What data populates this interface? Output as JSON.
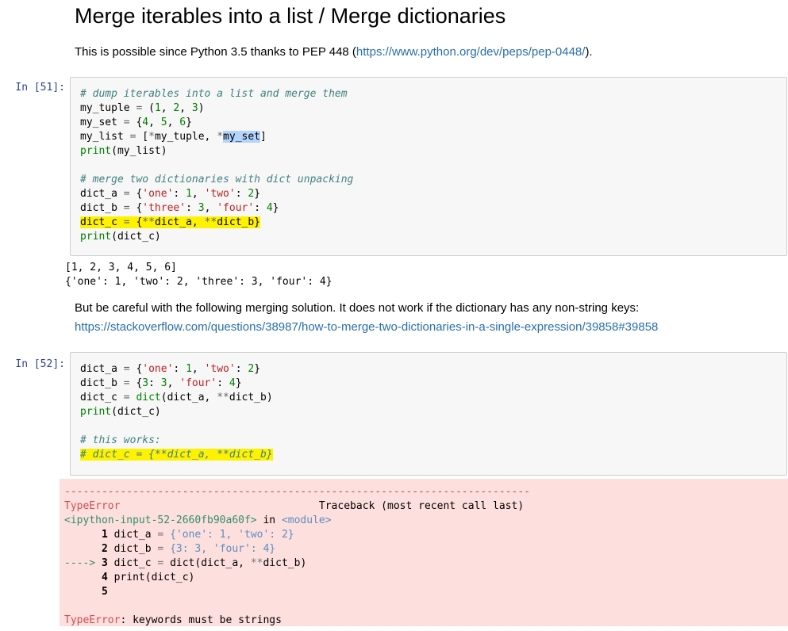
{
  "heading": "Merge iterables into a list / Merge dictionaries",
  "intro": {
    "prefix": "This is possible since Python 3.5 thanks to PEP 448 (",
    "link": "https://www.python.org/dev/peps/pep-0448/",
    "suffix": ")."
  },
  "cell51": {
    "prompt": "In [51]:",
    "comment1": "# dump iterables into a list and merge them",
    "comment2": "# merge two dictionaries with dict unpacking",
    "output": [
      "[1, 2, 3, 4, 5, 6]",
      "{'one': 1, 'two': 2, 'three': 3, 'four': 4}"
    ]
  },
  "note": {
    "text": "But be careful with the following merging solution. It does not work if the dictionary has any non-string keys:",
    "link": "https://stackoverflow.com/questions/38987/how-to-merge-two-dictionaries-in-a-single-expression/39858#39858"
  },
  "cell52": {
    "prompt": "In [52]:",
    "comment1": "# this works:",
    "comment2": "# dict_c = {**dict_a, **dict_b}"
  },
  "traceback": {
    "divider": "---------------------------------------------------------------------------",
    "error_type": "TypeError",
    "header_right": "Traceback (most recent call last)",
    "location": "<ipython-input-52-2660fb90a60f>",
    "in_word": "in",
    "module": "<module>",
    "arrow": "---->",
    "final_message": ": keywords must be strings"
  },
  "colors": {
    "prompt": "#303f9f",
    "highlight": "#fff200",
    "error_bg": "#fddfdd",
    "link": "#296eaa"
  }
}
